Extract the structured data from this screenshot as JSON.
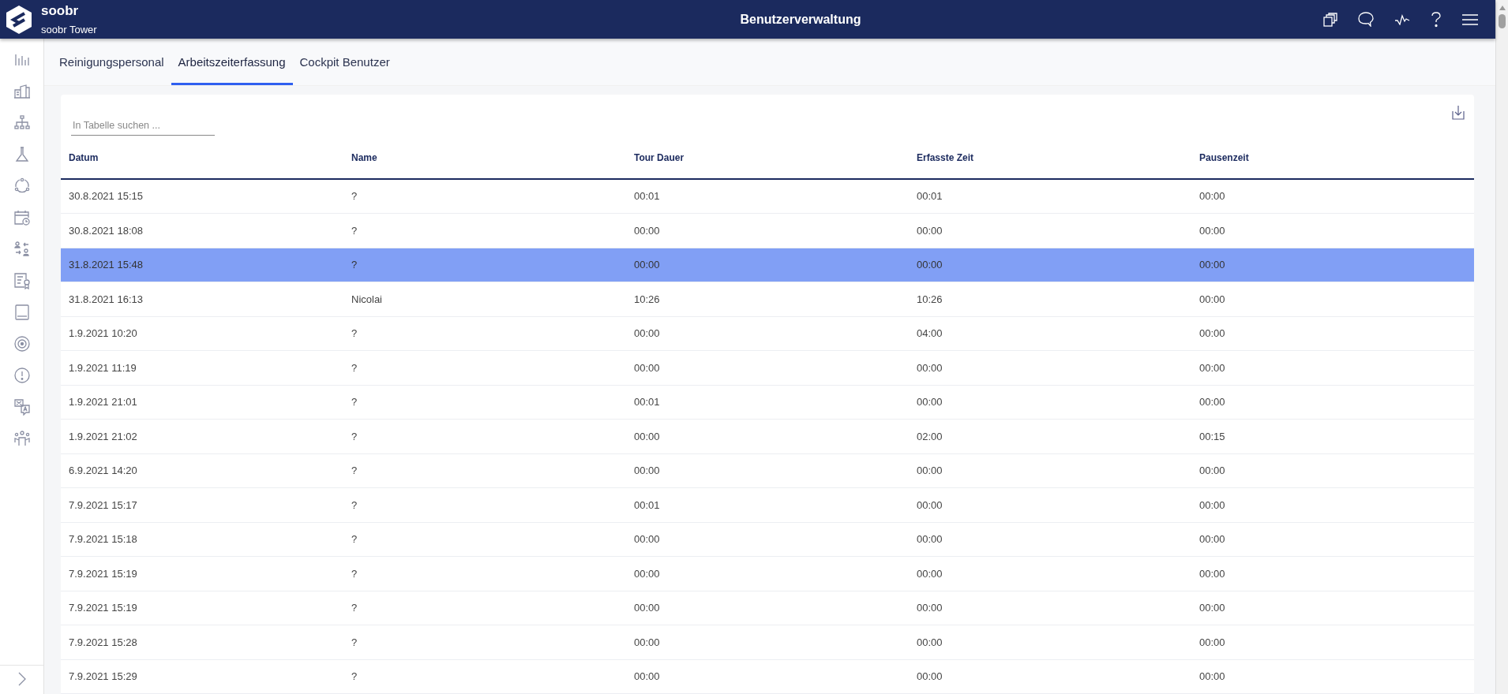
{
  "header": {
    "brand": "soobr",
    "subtitle": "soobr Tower",
    "title": "Benutzerverwaltung"
  },
  "tabs": [
    {
      "label": "Reinigungspersonal",
      "selected": false
    },
    {
      "label": "Arbeitszeiterfassung",
      "selected": true
    },
    {
      "label": "Cockpit Benutzer",
      "selected": false
    }
  ],
  "search": {
    "placeholder": "In Tabelle suchen ..."
  },
  "table": {
    "columns": [
      "Datum",
      "Name",
      "Tour Dauer",
      "Erfasste Zeit",
      "Pausenzeit"
    ],
    "rows": [
      {
        "cells": [
          "30.8.2021 15:15",
          "?",
          "00:01",
          "00:01",
          "00:00"
        ],
        "selected": false
      },
      {
        "cells": [
          "30.8.2021 18:08",
          "?",
          "00:00",
          "00:00",
          "00:00"
        ],
        "selected": false
      },
      {
        "cells": [
          "31.8.2021 15:48",
          "?",
          "00:00",
          "00:00",
          "00:00"
        ],
        "selected": true
      },
      {
        "cells": [
          "31.8.2021 16:13",
          "Nicolai",
          "10:26",
          "10:26",
          "00:00"
        ],
        "selected": false
      },
      {
        "cells": [
          "1.9.2021 10:20",
          "?",
          "00:00",
          "04:00",
          "00:00"
        ],
        "selected": false
      },
      {
        "cells": [
          "1.9.2021 11:19",
          "?",
          "00:00",
          "00:00",
          "00:00"
        ],
        "selected": false
      },
      {
        "cells": [
          "1.9.2021 21:01",
          "?",
          "00:01",
          "00:00",
          "00:00"
        ],
        "selected": false
      },
      {
        "cells": [
          "1.9.2021 21:02",
          "?",
          "00:00",
          "02:00",
          "00:15"
        ],
        "selected": false
      },
      {
        "cells": [
          "6.9.2021 14:20",
          "?",
          "00:00",
          "00:00",
          "00:00"
        ],
        "selected": false
      },
      {
        "cells": [
          "7.9.2021 15:17",
          "?",
          "00:01",
          "00:00",
          "00:00"
        ],
        "selected": false
      },
      {
        "cells": [
          "7.9.2021 15:18",
          "?",
          "00:00",
          "00:00",
          "00:00"
        ],
        "selected": false
      },
      {
        "cells": [
          "7.9.2021 15:19",
          "?",
          "00:00",
          "00:00",
          "00:00"
        ],
        "selected": false
      },
      {
        "cells": [
          "7.9.2021 15:19",
          "?",
          "00:00",
          "00:00",
          "00:00"
        ],
        "selected": false
      },
      {
        "cells": [
          "7.9.2021 15:28",
          "?",
          "00:00",
          "00:00",
          "00:00"
        ],
        "selected": false
      },
      {
        "cells": [
          "7.9.2021 15:29",
          "?",
          "00:00",
          "00:00",
          "00:00"
        ],
        "selected": false
      }
    ]
  }
}
